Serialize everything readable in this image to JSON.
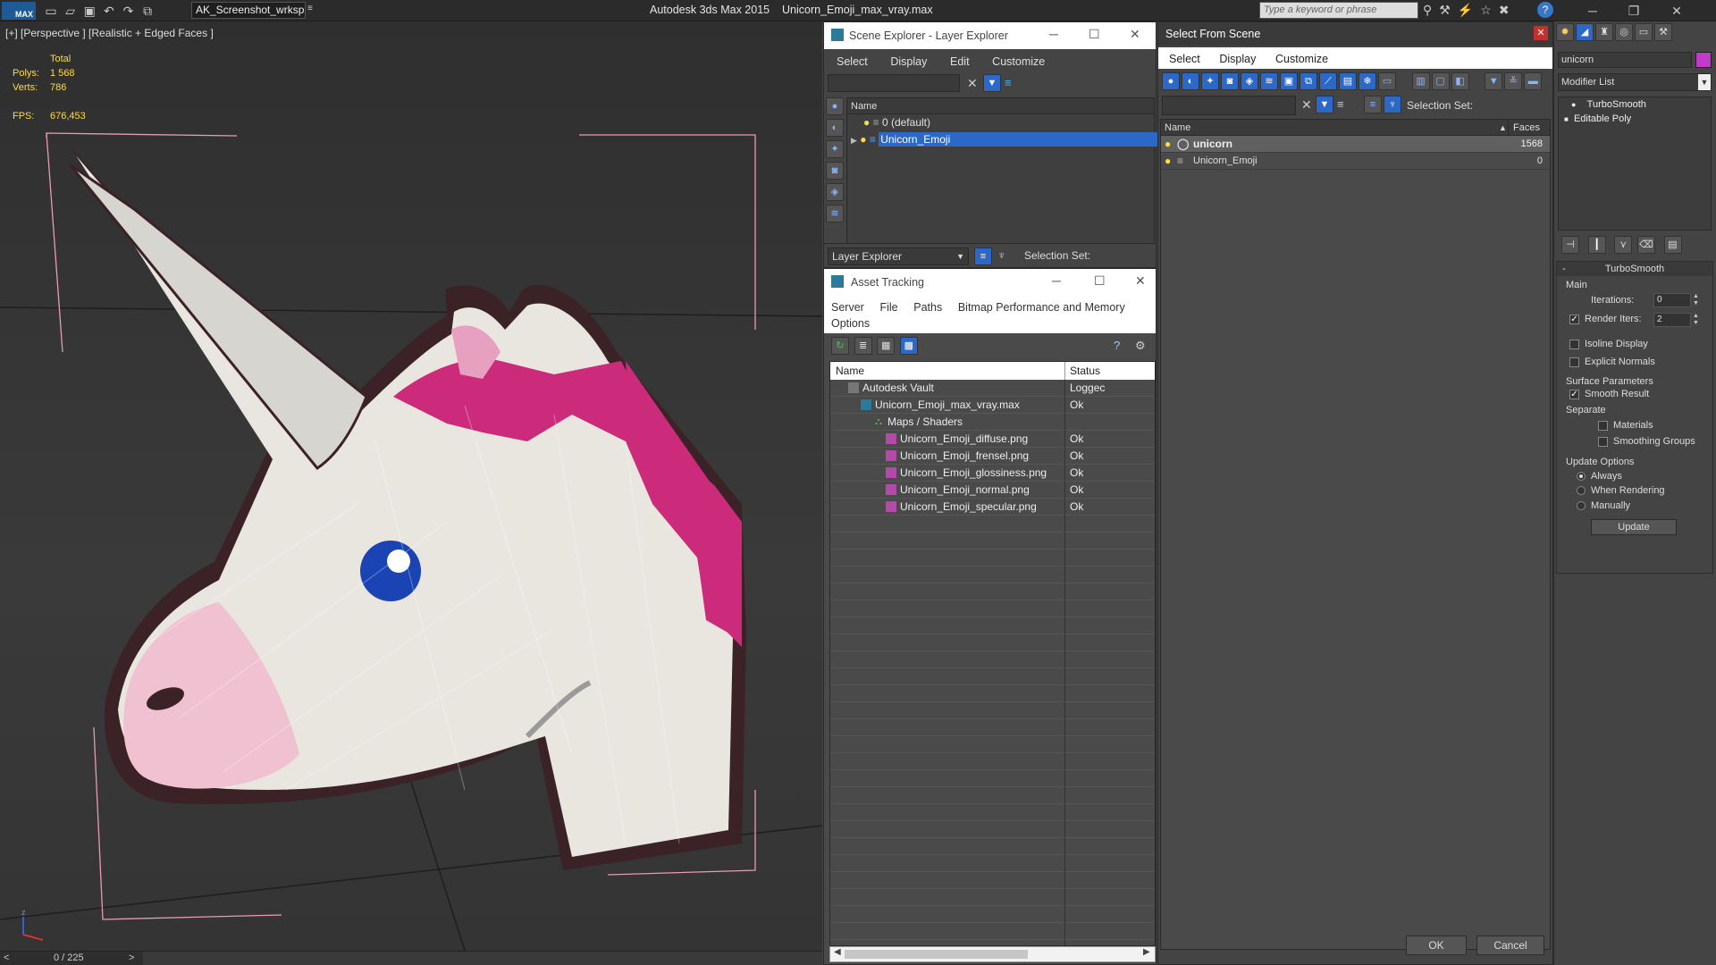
{
  "titlebar": {
    "app_title": "Autodesk 3ds Max  2015",
    "file_name": "Unicorn_Emoji_max_vray.max",
    "workspace": "AK_Screenshot_wrksp",
    "search_placeholder": "Type a keyword or phrase",
    "logo": "MAX"
  },
  "viewport": {
    "label": "[+] [Perspective ] [Realistic + Edged Faces ]",
    "stats": {
      "total_label": "Total",
      "polys_label": "Polys:",
      "polys": "1 568",
      "verts_label": "Verts:",
      "verts": "786",
      "fps_label": "FPS:",
      "fps": "676,453"
    },
    "timeline": {
      "frame": "0 / 225",
      "prev": "<",
      "next": ">"
    }
  },
  "scene_explorer": {
    "title": "Scene Explorer - Layer Explorer",
    "menu": [
      "Select",
      "Display",
      "Edit",
      "Customize"
    ],
    "column": "Name",
    "layers": [
      {
        "name": "0 (default)",
        "selected": false
      },
      {
        "name": "Unicorn_Emoji",
        "selected": true
      }
    ],
    "footer_dropdown": "Layer Explorer",
    "selection_set_label": "Selection Set:"
  },
  "asset_tracking": {
    "title": "Asset Tracking",
    "menu": [
      "Server",
      "File",
      "Paths",
      "Bitmap Performance and Memory"
    ],
    "menu2": "Options",
    "col_name": "Name",
    "col_status": "Status",
    "rows": [
      {
        "name": "Autodesk Vault",
        "status": "Loggec",
        "indent": 0
      },
      {
        "name": "Unicorn_Emoji_max_vray.max",
        "status": "Ok",
        "indent": 1
      },
      {
        "name": "Maps / Shaders",
        "status": "",
        "indent": 2
      },
      {
        "name": "Unicorn_Emoji_diffuse.png",
        "status": "Ok",
        "indent": 3
      },
      {
        "name": "Unicorn_Emoji_frensel.png",
        "status": "Ok",
        "indent": 3
      },
      {
        "name": "Unicorn_Emoji_glossiness.png",
        "status": "Ok",
        "indent": 3
      },
      {
        "name": "Unicorn_Emoji_normal.png",
        "status": "Ok",
        "indent": 3
      },
      {
        "name": "Unicorn_Emoji_specular.png",
        "status": "Ok",
        "indent": 3
      }
    ]
  },
  "select_from_scene": {
    "title": "Select From Scene",
    "menu": [
      "Select",
      "Display",
      "Customize"
    ],
    "selection_set_label": "Selection Set:",
    "col_name": "Name",
    "col_faces": "Faces",
    "rows": [
      {
        "name": "unicorn",
        "faces": "1568",
        "selected": true
      },
      {
        "name": "Unicorn_Emoji",
        "faces": "0",
        "selected": false
      }
    ],
    "ok": "OK",
    "cancel": "Cancel"
  },
  "modify_panel": {
    "object_name": "unicorn",
    "modifier_list": "Modifier List",
    "stack": [
      "TurboSmooth",
      "Editable Poly"
    ],
    "rollout_title": "TurboSmooth",
    "main_label": "Main",
    "iterations_label": "Iterations:",
    "iterations": "0",
    "render_iters_label": "Render Iters:",
    "render_iters": "2",
    "isoline": "Isoline Display",
    "explicit_normals": "Explicit Normals",
    "surface_params": "Surface Parameters",
    "smooth_result": "Smooth Result",
    "separate": "Separate",
    "materials": "Materials",
    "smoothing_groups": "Smoothing Groups",
    "update_options": "Update Options",
    "always": "Always",
    "when_rendering": "When Rendering",
    "manually": "Manually",
    "update_btn": "Update",
    "rollout_minus": "-"
  },
  "colors": {
    "accent": "#2c68c8",
    "magenta": "#cc2a7a",
    "stats": "#ffdd44"
  }
}
